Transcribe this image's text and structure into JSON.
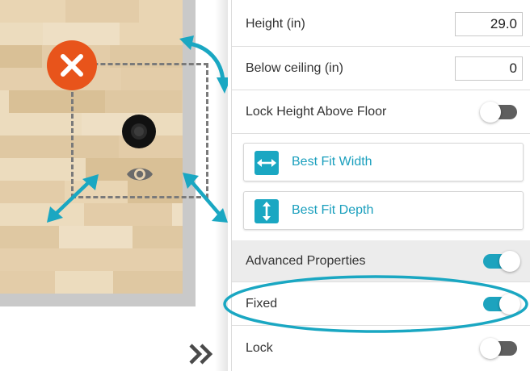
{
  "canvas": {
    "colors": {
      "delete": "#e8541b",
      "handles": "#1aa7c2",
      "selection_border": "#7a7a7a",
      "floor": "#e7d2b0",
      "wall": "#c9c9c9"
    },
    "icons": {
      "delete": "close-icon",
      "rotate": "rotate-arrow-icon",
      "resize_left": "resize-diagonal-icon",
      "resize_right": "resize-diagonal-icon",
      "visibility": "eye-icon",
      "collapse": "double-chevron-right-icon"
    }
  },
  "properties": {
    "height": {
      "label": "Height (in)",
      "value": "29.0"
    },
    "below_ceiling": {
      "label": "Below ceiling (in)",
      "value": "0"
    },
    "lock_height": {
      "label": "Lock Height Above Floor",
      "on": false
    },
    "best_fit_width": {
      "label": "Best Fit Width",
      "icon": "arrows-horizontal-icon"
    },
    "best_fit_depth": {
      "label": "Best Fit Depth",
      "icon": "arrows-vertical-icon"
    },
    "advanced": {
      "label": "Advanced Properties",
      "on": true
    },
    "fixed": {
      "label": "Fixed",
      "on": true
    },
    "lock": {
      "label": "Lock",
      "on": false
    }
  },
  "colors": {
    "accent": "#1aa7c2",
    "toggle_off": "#5f5f5f",
    "highlight": "#1aa7c2"
  }
}
